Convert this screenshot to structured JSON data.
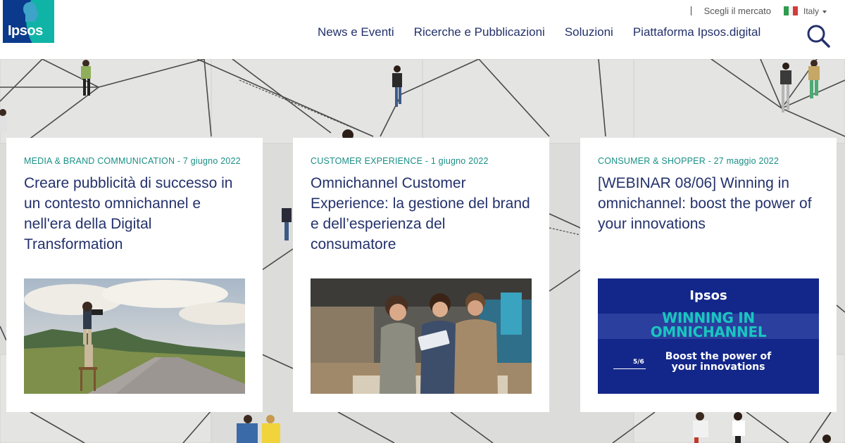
{
  "brand": {
    "logo_text": "Ipsos",
    "teal": "#0fb4a6",
    "navy": "#0b3a8c"
  },
  "utility": {
    "market_label": "Scegli il mercato",
    "language": "Italy"
  },
  "nav": {
    "items": [
      "News e Eventi",
      "Ricerche e Pubblicazioni",
      "Soluzioni",
      "Piattaforma Ipsos.digital"
    ]
  },
  "cards": [
    {
      "meta": "MEDIA & BRAND COMMUNICATION - 7 giugno 2022",
      "title": "Creare pubblicità di successo in un contesto omnichannel e nell'era della Digital Transformation"
    },
    {
      "meta": "CUSTOMER EXPERIENCE - 1 giugno 2022",
      "title": "Omnichannel Customer Experience: la gestione del brand e dell’esperienza del consumatore"
    },
    {
      "meta": "CONSUMER & SHOPPER - 27 maggio 2022",
      "title": "[WEBINAR 08/06] Winning in omnichannel: boost the power of your innovations"
    }
  ],
  "webinar_image": {
    "logo": "Ipsos",
    "headline_1": "WINNING IN",
    "headline_2": "OMNICHANNEL",
    "subline_1": "Boost the power of",
    "subline_2": "your innovations",
    "page": "5/6"
  }
}
